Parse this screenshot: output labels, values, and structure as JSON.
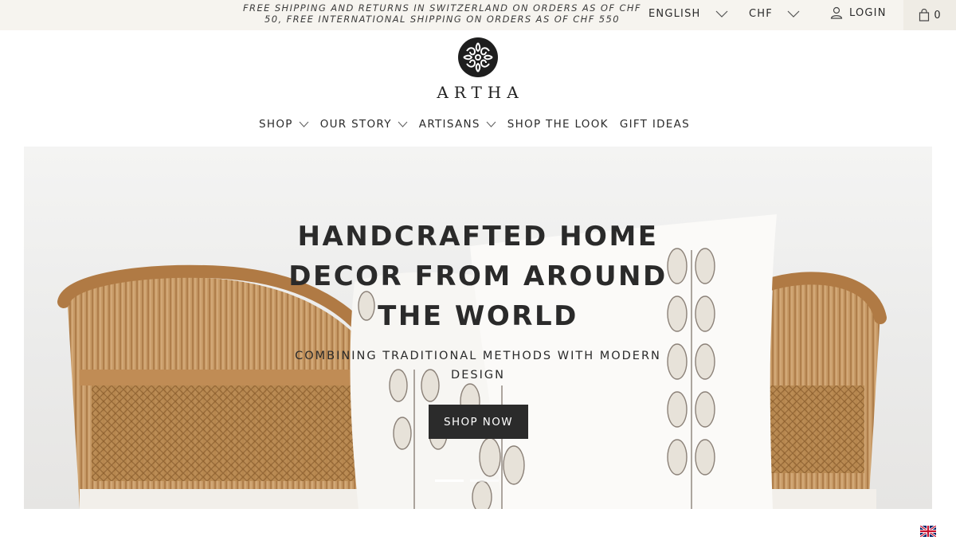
{
  "topbar": {
    "promo_text": "FREE SHIPPING AND RETURNS IN SWITZERLAND ON ORDERS AS OF CHF 50, FREE INTERNATIONAL SHIPPING ON ORDERS AS OF CHF 550",
    "language": "ENGLISH",
    "currency": "CHF",
    "login_label": "LOGIN",
    "cart_count": "0",
    "bg_color": "#f6f4ef"
  },
  "brand": {
    "name": "ARTHA",
    "logo_icon": "ornamental-circle-logo-icon"
  },
  "nav": {
    "items": [
      {
        "label": "SHOP",
        "has_dropdown": true
      },
      {
        "label": "OUR STORY",
        "has_dropdown": true
      },
      {
        "label": "ARTISANS",
        "has_dropdown": true
      },
      {
        "label": "SHOP THE LOOK",
        "has_dropdown": false
      },
      {
        "label": "GIFT IDEAS",
        "has_dropdown": false
      }
    ]
  },
  "hero": {
    "title": "HANDCRAFTED HOME DECOR FROM AROUND THE WORLD",
    "subtitle": "COMBINING TRADITIONAL METHODS WITH MODERN DESIGN",
    "cta_label": "SHOP NOW",
    "slide_count": 2,
    "active_slide": 1,
    "button_color": "#2b2b2b"
  },
  "footer_flag": {
    "icon": "uk-flag-icon"
  }
}
